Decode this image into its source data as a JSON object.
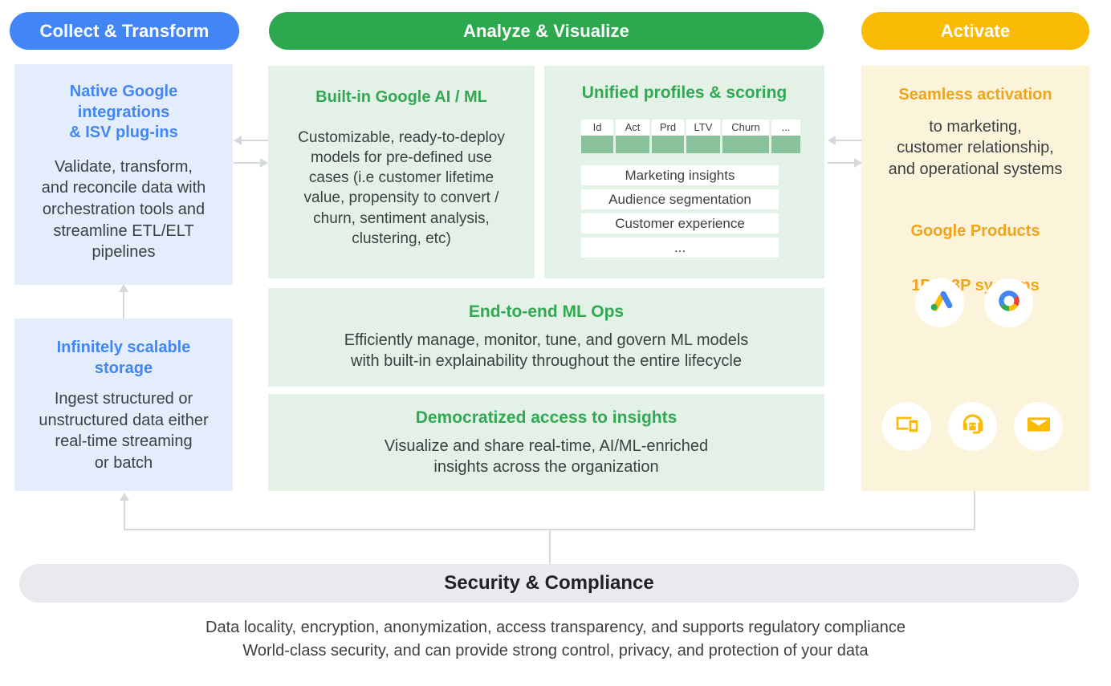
{
  "headers": {
    "collect": "Collect & Transform",
    "analyze": "Analyze & Visualize",
    "activate": "Activate"
  },
  "colors": {
    "blue": "#4285F4",
    "green": "#2EA84F",
    "yellow": "#FABB05",
    "panel_blue": "#E4EDFB",
    "panel_green": "#E4F1E7",
    "panel_amber": "#FCF3DB",
    "table_cell_green": "#87C29A",
    "security_bar": "#E8EAED",
    "connector": "#d6d8dc"
  },
  "collect": {
    "native": {
      "title": "Native Google\nintegrations\n& ISV plug-ins",
      "body": "Validate, transform,\nand reconcile data with\norchestration tools and\nstreamline ETL/ELT\npipelines"
    },
    "storage": {
      "title": "Infinitely scalable\nstorage",
      "body": "Ingest structured or\nunstructured data either\nreal-time streaming\nor batch"
    }
  },
  "analyze": {
    "ai_ml": {
      "title": "Built-in Google AI / ML",
      "body": "Customizable, ready-to-deploy\nmodels for pre-defined use\ncases (i.e customer lifetime\nvalue, propensity to convert /\nchurn, sentiment analysis,\nclustering, etc)"
    },
    "profiles": {
      "title": "Unified profiles & scoring",
      "table_headers": [
        "Id",
        "Act",
        "Prd",
        "LTV",
        "Churn",
        "..."
      ],
      "rows": [
        "Marketing insights",
        "Audience segmentation",
        "Customer experience",
        "..."
      ]
    },
    "mlops": {
      "title": "End-to-end ML Ops",
      "body": "Efficiently manage, monitor, tune, and govern ML models\nwith built-in explainability throughout the entire lifecycle"
    },
    "insights": {
      "title": "Democratized access to insights",
      "body": "Visualize and share real-time, AI/ML-enriched\ninsights across the organization"
    }
  },
  "activate": {
    "title": "Seamless activation",
    "body": "to marketing,\ncustomer relationship,\nand operational systems",
    "google_products_label": "Google Products",
    "google_products": [
      "google-ads-icon",
      "google-marketing-platform-icon"
    ],
    "systems_label": "1P & 3P systems",
    "systems": [
      "devices-icon",
      "support-agent-icon",
      "email-icon"
    ]
  },
  "security": {
    "title": "Security & Compliance",
    "body": "Data locality, encryption, anonymization, access transparency, and supports regulatory compliance\nWorld-class security, and can provide strong control, privacy, and protection of your data"
  }
}
